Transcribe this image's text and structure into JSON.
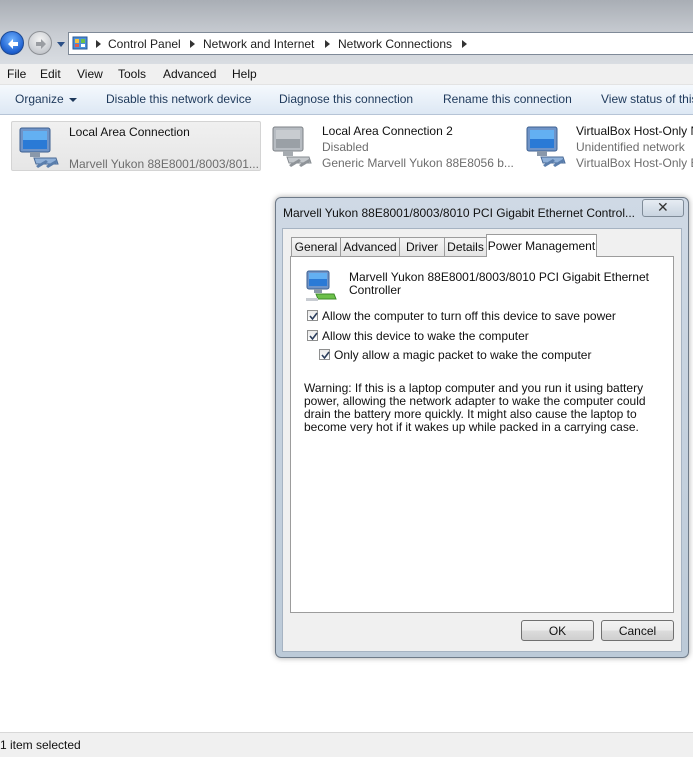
{
  "address_bar": {
    "breadcrumbs": [
      "Control Panel",
      "Network and Internet",
      "Network Connections"
    ]
  },
  "menu": [
    "File",
    "Edit",
    "View",
    "Tools",
    "Advanced",
    "Help"
  ],
  "command_bar": {
    "organize": "Organize",
    "disable": "Disable this network device",
    "diagnose": "Diagnose this connection",
    "rename": "Rename this connection",
    "view_status": "View status of this"
  },
  "connections": [
    {
      "name": "Local Area Connection",
      "status": "",
      "device": "Marvell Yukon 88E8001/8003/801..."
    },
    {
      "name": "Local Area Connection 2",
      "status": "Disabled",
      "device": "Generic Marvell Yukon 88E8056 b..."
    },
    {
      "name": "VirtualBox Host-Only N",
      "status": "Unidentified network",
      "device": "VirtualBox Host-Only E"
    }
  ],
  "status_bar": {
    "text": "1 item selected"
  },
  "dialog": {
    "title": "Marvell Yukon 88E8001/8003/8010 PCI Gigabit Ethernet Control...",
    "tabs": [
      "General",
      "Advanced",
      "Driver",
      "Details",
      "Power Management"
    ],
    "active_tab": "Power Management",
    "device_name": "Marvell Yukon 88E8001/8003/8010 PCI Gigabit Ethernet Controller",
    "options": [
      {
        "label": "Allow the computer to turn off this device to save power",
        "checked": true
      },
      {
        "label": "Allow this device to wake the computer",
        "checked": true
      },
      {
        "label": "Only allow a magic packet to wake the computer",
        "checked": true
      }
    ],
    "warning": "Warning: If this is a laptop computer and you run it using battery power, allowing the network adapter to wake the computer could drain the battery more quickly. It might also cause the laptop to become very hot if it wakes up while packed in a carrying case.",
    "ok_label": "OK",
    "cancel_label": "Cancel"
  }
}
